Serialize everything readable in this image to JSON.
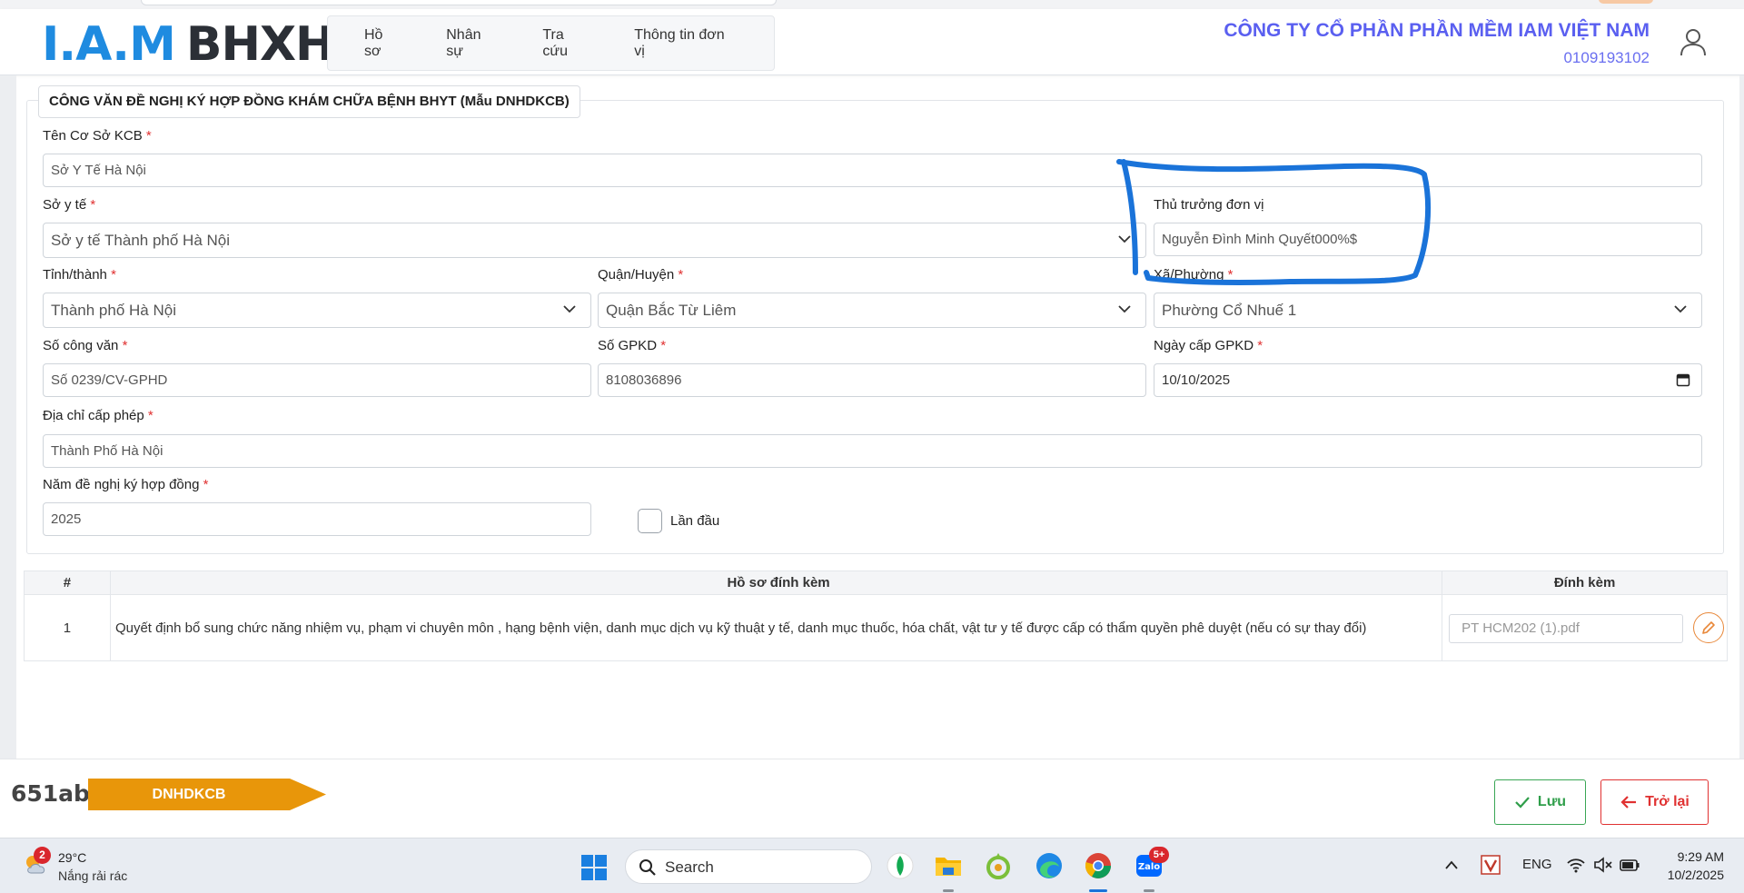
{
  "header": {
    "logo_iam": "I.A.M",
    "logo_bhxh": "BHXH",
    "nav": [
      "Hồ sơ",
      "Nhân sự",
      "Tra cứu",
      "Thông tin đơn vị"
    ],
    "company_name": "CÔNG TY CỔ PHẦN PHẦN MỀM IAM VIỆT NAM",
    "company_code": "0109193102",
    "icons": {
      "user": "user-icon"
    }
  },
  "form": {
    "legend": "CÔNG VĂN ĐỀ NGHỊ KÝ HỢP ĐỒNG KHÁM CHỮA BỆNH BHYT (Mẫu DNHDKCB)",
    "required_mark": "*",
    "ten_co_so": {
      "label": "Tên Cơ Sở KCB",
      "value": "Sở Y Tế Hà Nội"
    },
    "so_y_te": {
      "label": "Sở y tế",
      "value": "Sở y tế Thành phố Hà Nội"
    },
    "thu_truong": {
      "label": "Thủ trưởng đơn vị",
      "value": "Nguyễn Đình Minh Quyết000%$"
    },
    "tinh_thanh": {
      "label": "Tỉnh/thành",
      "value": "Thành phố Hà Nội"
    },
    "quan_huyen": {
      "label": "Quận/Huyện",
      "value": "Quận Bắc Từ Liêm"
    },
    "xa_phuong": {
      "label": "Xã/Phường",
      "value": "Phường Cổ Nhuế 1"
    },
    "so_cong_van": {
      "label": "Số công văn",
      "value": "Số 0239/CV-GPHD"
    },
    "so_gpkd": {
      "label": "Số GPKD",
      "value": "8108036896"
    },
    "ngay_cap": {
      "label": "Ngày cấp GPKD",
      "value": "10/10/2025"
    },
    "dia_chi": {
      "label": "Địa chỉ cấp phép",
      "value": "Thành Phố Hà Nội"
    },
    "nam_de_nghi": {
      "label": "Năm đề nghị ký hợp đồng",
      "value": "2025"
    },
    "lan_dau": {
      "label": "Lần đầu",
      "checked": false
    }
  },
  "table": {
    "headers": [
      "#",
      "Hồ sơ đính kèm",
      "Đính kèm"
    ],
    "rows": [
      {
        "num": "1",
        "doc": "Quyết định bổ sung chức năng nhiệm vụ, phạm vi chuyên môn , hạng bệnh viện, danh mục dịch vụ kỹ thuật y tế, danh mục thuốc, hóa chất, vật tư y tế được cấp có thẩm quyền phê duyệt (nếu có sự thay đổi)",
        "file": "PT HCM202 (1).pdf"
      }
    ]
  },
  "footer": {
    "code": "651ab",
    "tag": "DNHDKCB",
    "save_label": "Lưu",
    "back_label": "Trở lại",
    "colors": {
      "tag": "#e8960a",
      "save": "#2f9e4a",
      "back": "#e03131"
    }
  },
  "taskbar": {
    "weather_badge": "2",
    "temperature": "29°C",
    "condition": "Nắng rải rác",
    "search_placeholder": "Search",
    "mail_badge": "5+",
    "language": "ENG",
    "time": "9:29 AM",
    "date": "10/2/2025"
  }
}
